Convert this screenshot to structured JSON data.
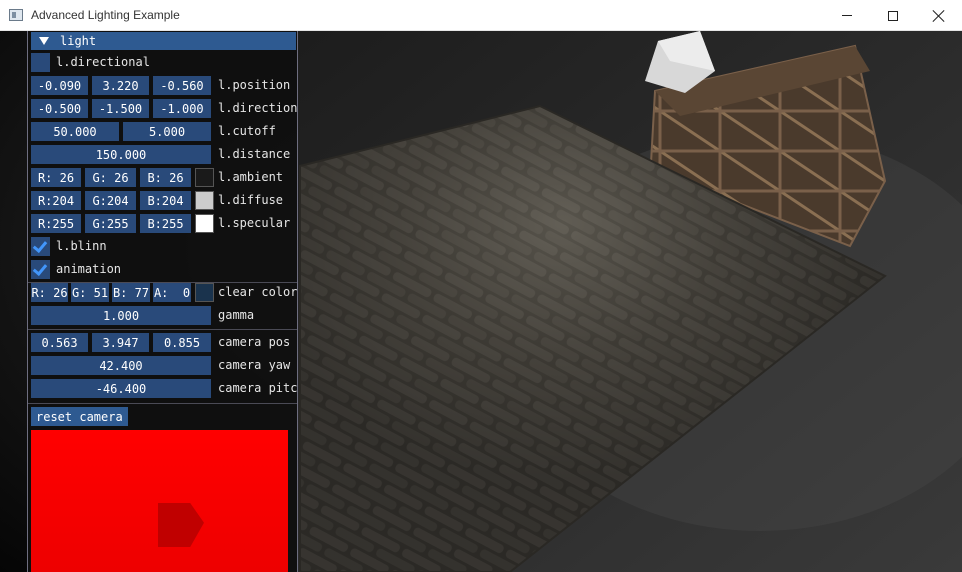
{
  "window": {
    "title": "Advanced Lighting Example"
  },
  "panel": {
    "header": "light",
    "directional": {
      "label": "l.directional",
      "checked": false
    },
    "position": {
      "values": [
        "-0.090",
        "3.220",
        "-0.560"
      ],
      "label": "l.position"
    },
    "direction": {
      "values": [
        "-0.500",
        "-1.500",
        "-1.000"
      ],
      "label": "l.direction"
    },
    "cutoff": {
      "values": [
        "50.000",
        "5.000"
      ],
      "label": "l.cutoff"
    },
    "distance": {
      "value": "150.000",
      "label": "l.distance"
    },
    "ambient": {
      "values": [
        "R: 26",
        "G: 26",
        "B: 26"
      ],
      "label": "l.ambient",
      "color": "#1a1a1a"
    },
    "diffuse": {
      "values": [
        "R:204",
        "G:204",
        "B:204"
      ],
      "label": "l.diffuse",
      "color": "#cccccc"
    },
    "specular": {
      "values": [
        "R:255",
        "G:255",
        "B:255"
      ],
      "label": "l.specular",
      "color": "#ffffff"
    },
    "blinn": {
      "label": "l.blinn",
      "checked": true
    },
    "animation": {
      "label": "animation",
      "checked": true
    },
    "clear_color": {
      "values": [
        "R: 26",
        "G: 51",
        "B: 77",
        "A:  0"
      ],
      "label": "clear color",
      "color": "#1a334d"
    },
    "gamma": {
      "value": "1.000",
      "label": "gamma"
    },
    "camera_pos": {
      "values": [
        "0.563",
        "3.947",
        "0.855"
      ],
      "label": "camera pos"
    },
    "camera_yaw": {
      "value": "42.400",
      "label": "camera yaw"
    },
    "camera_pitch": {
      "value": "-46.400",
      "label": "camera pitch"
    },
    "reset_camera": "reset camera"
  },
  "colors": {
    "accent": "#2e5a91",
    "frame_bg": "#294a7a",
    "check": "#4296fa",
    "panel_bg": "#0f0f0f",
    "texture_preview": "#ff0000"
  }
}
